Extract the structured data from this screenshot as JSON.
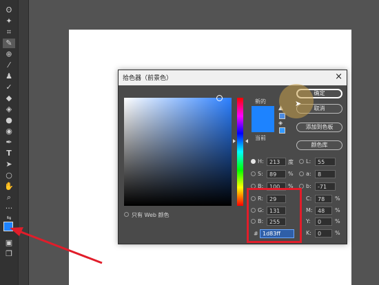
{
  "colors": {
    "new_color": "#1d83ff",
    "current_color": "#1d83ff",
    "accent_red": "#e11d2a",
    "hover_circle": "#c8a04a"
  },
  "toolbar": {
    "icons": [
      "lasso-icon",
      "magic-wand-icon",
      "crop-icon",
      "eyedropper-icon",
      "healing-icon",
      "brush-icon",
      "stamp-icon",
      "history-brush-icon",
      "eraser-icon",
      "bucket-icon",
      "blur-icon",
      "dodge-icon",
      "pen-icon",
      "type-icon",
      "path-select-icon",
      "shape-icon",
      "hand-icon",
      "zoom-icon",
      "more-icon"
    ]
  },
  "dialog": {
    "title": "拾色器（前景色）",
    "close": "×",
    "new_label": "新的",
    "current_label": "当前",
    "web_only_label": "只有 Web 颜色",
    "buttons": {
      "ok": "确定",
      "cancel": "取消",
      "add_swatch": "添加到色板",
      "color_library": "颜色库"
    },
    "hsb": {
      "h_label": "H:",
      "h_value": "213",
      "h_unit": "度",
      "s_label": "S:",
      "s_value": "89",
      "s_unit": "%",
      "b_label": "B:",
      "b_value": "100",
      "b_unit": "%"
    },
    "lab": {
      "l_label": "L:",
      "l_value": "55",
      "a_label": "a:",
      "a_value": "8",
      "b_label": "b:",
      "b_value": "-71"
    },
    "rgb": {
      "r_label": "R:",
      "r_value": "29",
      "g_label": "G:",
      "g_value": "131",
      "b_label": "B:",
      "b_value": "255"
    },
    "cmyk": {
      "c_label": "C:",
      "c_value": "78",
      "c_unit": "%",
      "m_label": "M:",
      "m_value": "48",
      "m_unit": "%",
      "y_label": "Y:",
      "y_value": "0",
      "y_unit": "%",
      "k_label": "K:",
      "k_value": "0",
      "k_unit": "%"
    },
    "hex_label": "#",
    "hex_value": "1d83ff"
  }
}
